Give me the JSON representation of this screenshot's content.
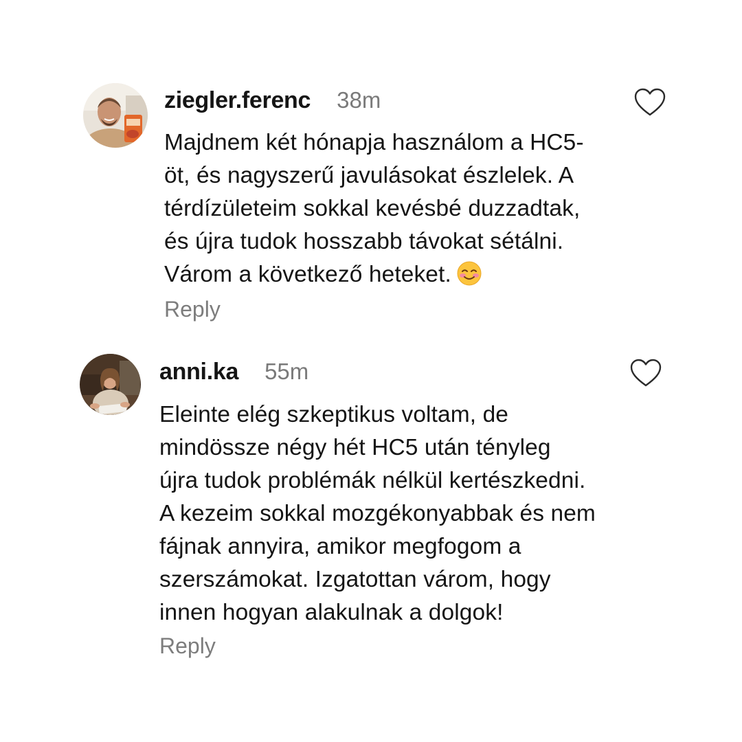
{
  "comments": [
    {
      "username": "ziegler.ferenc",
      "time": "38m",
      "lines": [
        "Majdnem két hónapja használom a HC5-",
        "öt, és nagyszerű javulásokat észlelek. A",
        "térdízületeim sokkal kevésbé duzzadtak,",
        "és újra tudok hosszabb távokat sétálni.",
        "Várom a következő heteket."
      ],
      "emoji": "smiling-face-with-blush-icon",
      "reply": "Reply"
    },
    {
      "username": "anni.ka",
      "time": "55m",
      "lines": [
        "Eleinte elég szkeptikus voltam, de",
        "mindössze négy hét HC5 után tényleg",
        "újra tudok problémák nélkül kertészkedni.",
        "A kezeim sokkal mozgékonyabbak és nem",
        "fájnak annyira, amikor megfogom a",
        "szerszámokat. Izgatottan várom, hogy",
        "innen hogyan alakulnak a dolgok!"
      ],
      "reply": "Reply"
    }
  ],
  "colors": {
    "text": "#151515",
    "muted": "#7a7a7a",
    "heart_stroke": "#2b2b2b",
    "background": "#ffffff"
  }
}
